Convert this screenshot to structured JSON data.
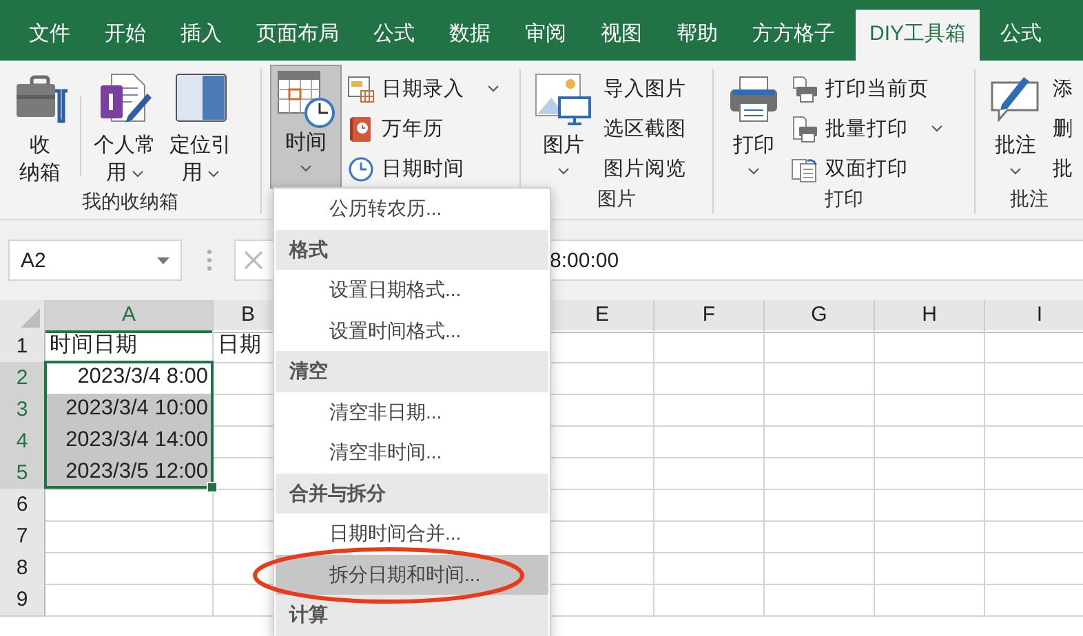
{
  "tabs": [
    {
      "label": "文件",
      "selected": false
    },
    {
      "label": "开始",
      "selected": false
    },
    {
      "label": "插入",
      "selected": false
    },
    {
      "label": "页面布局",
      "selected": false
    },
    {
      "label": "公式",
      "selected": false
    },
    {
      "label": "数据",
      "selected": false
    },
    {
      "label": "审阅",
      "selected": false
    },
    {
      "label": "视图",
      "selected": false
    },
    {
      "label": "帮助",
      "selected": false
    },
    {
      "label": "方方格子",
      "selected": false
    },
    {
      "label": "DIY工具箱",
      "selected": true
    },
    {
      "label": "公式",
      "selected": false
    }
  ],
  "ribbon": {
    "groups": [
      {
        "label": "我的收纳箱",
        "large": [
          {
            "lines": [
              "收",
              "纳箱"
            ],
            "dropdown": false,
            "pressed": false
          },
          {
            "lines": [
              "个人常",
              "用"
            ],
            "dropdown": true,
            "pressed": false
          },
          {
            "lines": [
              "定位引",
              "用"
            ],
            "dropdown": true,
            "pressed": false
          }
        ]
      },
      {
        "large": [
          {
            "lines": [
              "时间"
            ],
            "dropdown": true,
            "pressed": true
          }
        ],
        "small": [
          {
            "label": "日期录入",
            "dropdown": true
          },
          {
            "label": "万年历",
            "dropdown": false
          },
          {
            "label": "日期时间",
            "dropdown": false
          }
        ]
      },
      {
        "label": "图片",
        "large": [
          {
            "lines": [
              "图片"
            ],
            "dropdown": true,
            "pressed": false
          }
        ],
        "small": [
          {
            "label": "导入图片",
            "dropdown": false
          },
          {
            "label": "选区截图",
            "dropdown": false
          },
          {
            "label": "图片阅览",
            "dropdown": false
          }
        ]
      },
      {
        "label": "打印",
        "large": [
          {
            "lines": [
              "打印"
            ],
            "dropdown": true,
            "pressed": false
          }
        ],
        "small": [
          {
            "label": "打印当前页",
            "dropdown": false
          },
          {
            "label": "批量打印",
            "dropdown": true
          },
          {
            "label": "双面打印",
            "dropdown": false
          }
        ]
      },
      {
        "label": "批注",
        "large": [
          {
            "lines": [
              "批注"
            ],
            "dropdown": true,
            "pressed": false
          }
        ],
        "small": [
          {
            "label": "添",
            "dropdown": false
          },
          {
            "label": "删",
            "dropdown": false
          },
          {
            "label": "批",
            "dropdown": false
          }
        ]
      }
    ]
  },
  "name_box": "A2",
  "formula": "8:00:00",
  "columns": [
    {
      "label": "A",
      "selected": true
    },
    {
      "label": "B",
      "selected": false
    },
    {
      "label": "E",
      "selected": false
    },
    {
      "label": "F",
      "selected": false
    },
    {
      "label": "G",
      "selected": false
    },
    {
      "label": "H",
      "selected": false
    },
    {
      "label": "I",
      "selected": false
    }
  ],
  "rows": [
    {
      "label": "1",
      "selected": false,
      "cells": [
        {
          "text": "时间日期",
          "kind": "text",
          "selected": false
        },
        {
          "text": "日期",
          "kind": "text",
          "selected": false
        }
      ]
    },
    {
      "label": "2",
      "selected": true,
      "cells": [
        {
          "text": "2023/3/4 8:00",
          "kind": "date",
          "selected": false
        }
      ]
    },
    {
      "label": "3",
      "selected": true,
      "cells": [
        {
          "text": "2023/3/4 10:00",
          "kind": "date",
          "selected": true
        }
      ]
    },
    {
      "label": "4",
      "selected": true,
      "cells": [
        {
          "text": "2023/3/4 14:00",
          "kind": "date",
          "selected": true
        }
      ]
    },
    {
      "label": "5",
      "selected": true,
      "cells": [
        {
          "text": "2023/3/5 12:00",
          "kind": "date",
          "selected": true
        }
      ]
    },
    {
      "label": "6",
      "selected": false
    },
    {
      "label": "7",
      "selected": false
    },
    {
      "label": "8",
      "selected": false
    },
    {
      "label": "9",
      "selected": false
    }
  ],
  "menu": [
    {
      "kind": "item",
      "label": "公历转农历...",
      "selected": false
    },
    {
      "kind": "header",
      "label": "格式"
    },
    {
      "kind": "item",
      "label": "设置日期格式...",
      "selected": false
    },
    {
      "kind": "item",
      "label": "设置时间格式...",
      "selected": false
    },
    {
      "kind": "header",
      "label": "清空"
    },
    {
      "kind": "item",
      "label": "清空非日期...",
      "selected": false
    },
    {
      "kind": "item",
      "label": "清空非时间...",
      "selected": false
    },
    {
      "kind": "header",
      "label": "合并与拆分"
    },
    {
      "kind": "item",
      "label": "日期时间合并...",
      "selected": false
    },
    {
      "kind": "item",
      "label": "拆分日期和时间...",
      "selected": true
    },
    {
      "kind": "header",
      "label": "计算"
    }
  ]
}
